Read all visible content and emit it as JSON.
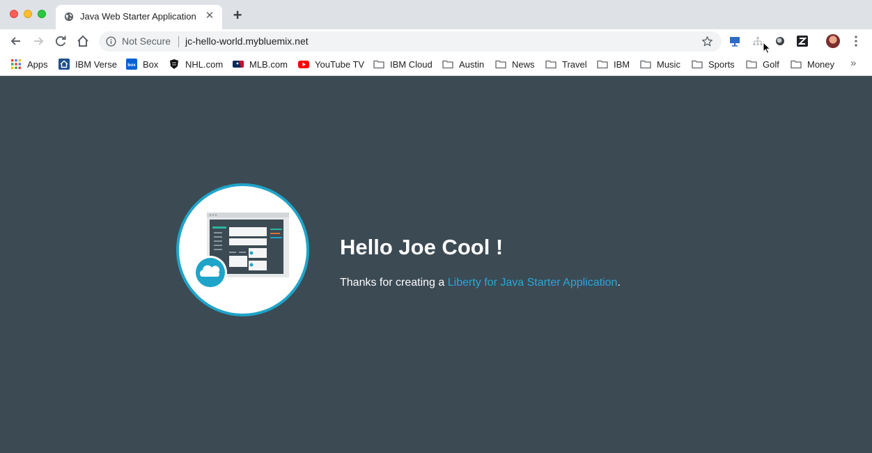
{
  "browser": {
    "tab": {
      "title": "Java Web Starter Application",
      "close_glyph": "✕",
      "icon": "globe-icon"
    },
    "new_tab_glyph": "+",
    "address_bar": {
      "security_label": "Not Secure",
      "url": "jc-hello-world.mybluemix.net"
    },
    "bookmarks": [
      {
        "label": "Apps",
        "icon": "apps-grid-icon"
      },
      {
        "label": "IBM Verse",
        "icon": "ibm-verse-icon"
      },
      {
        "label": "Box",
        "icon": "box-icon"
      },
      {
        "label": "NHL.com",
        "icon": "nhl-icon"
      },
      {
        "label": "MLB.com",
        "icon": "mlb-icon"
      },
      {
        "label": "YouTube TV",
        "icon": "youtube-icon"
      },
      {
        "label": "IBM Cloud",
        "icon": "folder-icon"
      },
      {
        "label": "Austin",
        "icon": "folder-icon"
      },
      {
        "label": "News",
        "icon": "folder-icon"
      },
      {
        "label": "Travel",
        "icon": "folder-icon"
      },
      {
        "label": "IBM",
        "icon": "folder-icon"
      },
      {
        "label": "Music",
        "icon": "folder-icon"
      },
      {
        "label": "Sports",
        "icon": "folder-icon"
      },
      {
        "label": "Golf",
        "icon": "folder-icon"
      },
      {
        "label": "Money",
        "icon": "folder-icon"
      }
    ],
    "bookmarks_overflow_glyph": "»"
  },
  "page": {
    "headline": "Hello Joe Cool !",
    "intro_text": "Thanks for creating a ",
    "link_text": "Liberty for Java Starter Application",
    "trailing_text": "."
  },
  "colors": {
    "page_background": "#3c4a53",
    "accent": "#1fa4c9",
    "link": "#29a8d8"
  }
}
